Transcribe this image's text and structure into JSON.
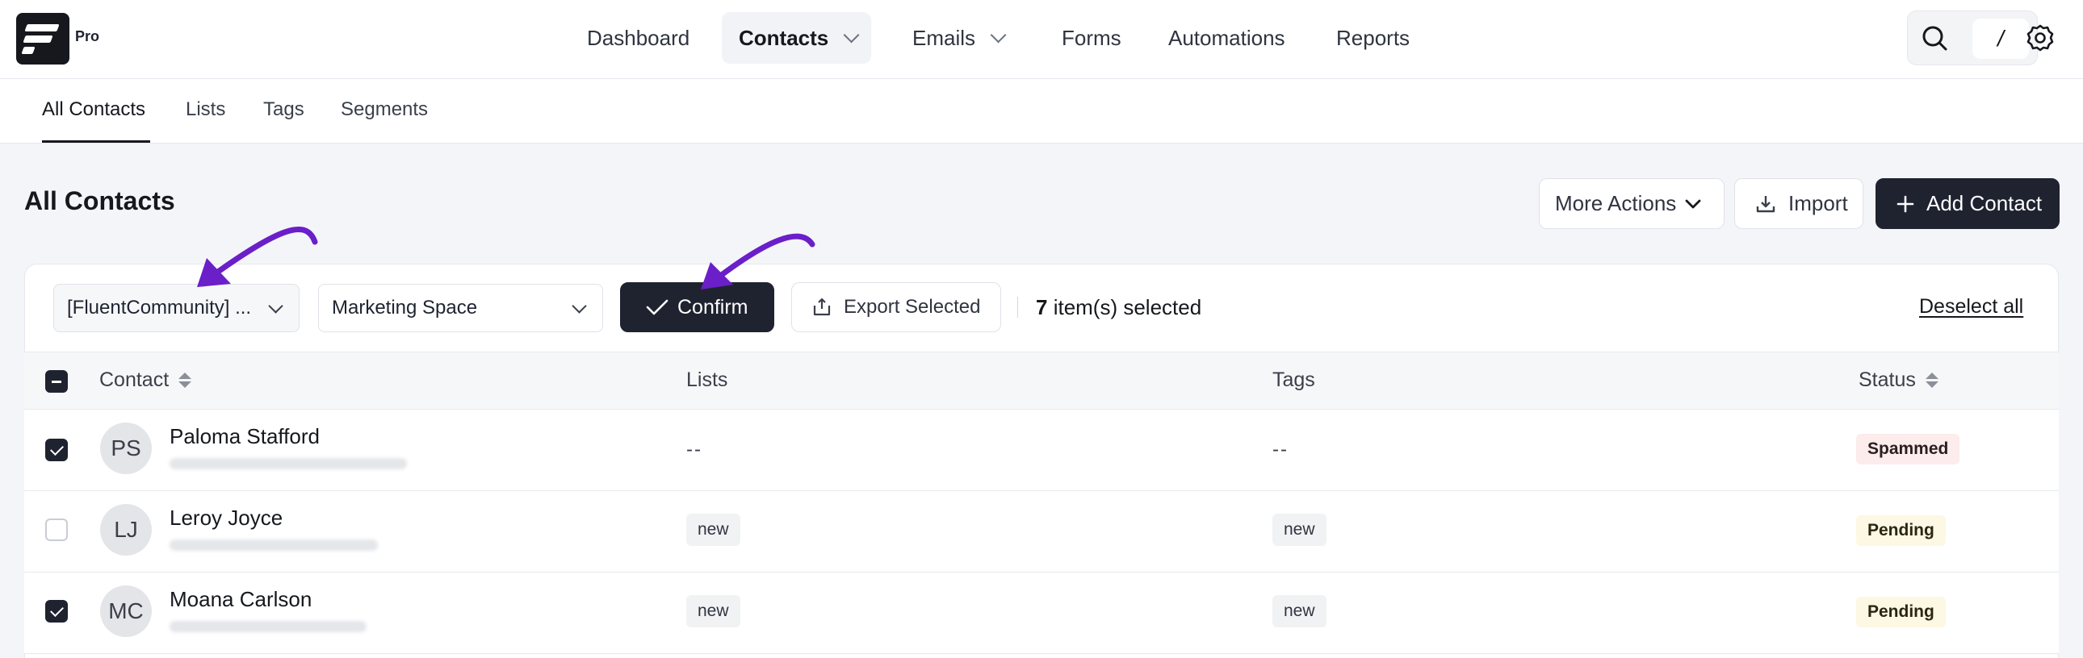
{
  "app": {
    "plan_badge": "Pro"
  },
  "nav": {
    "items": [
      {
        "label": "Dashboard",
        "active": false,
        "dropdown": false
      },
      {
        "label": "Contacts",
        "active": true,
        "dropdown": true
      },
      {
        "label": "Emails",
        "active": false,
        "dropdown": true
      },
      {
        "label": "Forms",
        "active": false,
        "dropdown": false
      },
      {
        "label": "Automations",
        "active": false,
        "dropdown": false
      },
      {
        "label": "Reports",
        "active": false,
        "dropdown": false
      }
    ],
    "search_shortcut": "/"
  },
  "subnav": {
    "tabs": [
      {
        "label": "All Contacts",
        "active": true
      },
      {
        "label": "Lists",
        "active": false
      },
      {
        "label": "Tags",
        "active": false
      },
      {
        "label": "Segments",
        "active": false
      }
    ]
  },
  "page": {
    "title": "All Contacts",
    "more_actions": "More Actions",
    "import": "Import",
    "add_contact": "Add Contact"
  },
  "bulk": {
    "space_select": "[FluentCommunity] ...",
    "target_select": "Marketing Space",
    "confirm": "Confirm",
    "export_selected": "Export Selected",
    "selected_count": "7",
    "selected_suffix": " item(s) selected",
    "deselect_all": "Deselect all"
  },
  "table": {
    "columns": {
      "contact": "Contact",
      "lists": "Lists",
      "tags": "Tags",
      "status": "Status"
    },
    "rows": [
      {
        "initials": "PS",
        "name": "Paloma Stafford",
        "checked": true,
        "lists": "--",
        "tags": "--",
        "status": "Spammed",
        "status_type": "spammed"
      },
      {
        "initials": "LJ",
        "name": "Leroy Joyce",
        "checked": false,
        "lists": "new",
        "tags": "new",
        "status": "Pending",
        "status_type": "pending"
      },
      {
        "initials": "MC",
        "name": "Moana Carlson",
        "checked": true,
        "lists": "new",
        "tags": "new",
        "status": "Pending",
        "status_type": "pending"
      }
    ]
  },
  "colors": {
    "accent_dark": "#1f2330",
    "annotation_arrow": "#6a1fc9"
  }
}
